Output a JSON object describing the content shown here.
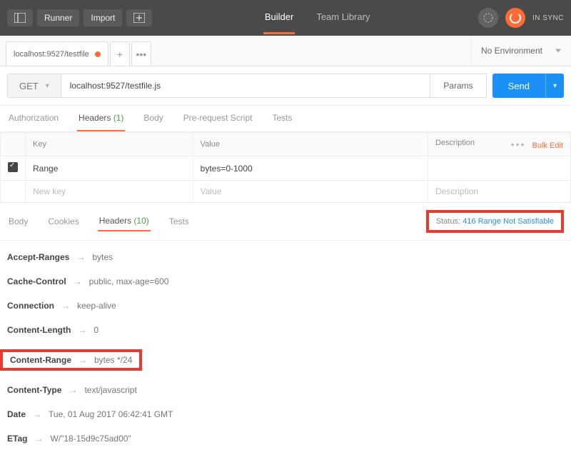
{
  "topbar": {
    "runner": "Runner",
    "import": "Import",
    "builder": "Builder",
    "team_library": "Team Library",
    "sync": "IN SYNC"
  },
  "tab": {
    "title": "localhost:9527/testfile",
    "add": "+",
    "more": "•••"
  },
  "env": {
    "label": "No Environment"
  },
  "request": {
    "method": "GET",
    "url": "localhost:9527/testfile.js",
    "params": "Params",
    "send": "Send"
  },
  "req_tabs": {
    "auth": "Authorization",
    "headers": "Headers",
    "headers_count": "(1)",
    "body": "Body",
    "prereq": "Pre-request Script",
    "tests": "Tests"
  },
  "headers_table": {
    "th_key": "Key",
    "th_value": "Value",
    "th_desc": "Description",
    "bulk": "Bulk Edit",
    "more": "•••",
    "row1_key": "Range",
    "row1_val": "bytes=0-1000",
    "ph_key": "New key",
    "ph_val": "Value",
    "ph_desc": "Description"
  },
  "res_tabs": {
    "body": "Body",
    "cookies": "Cookies",
    "headers": "Headers",
    "headers_count": "(10)",
    "tests": "Tests",
    "status_label": "Status:",
    "status_val": "416 Range Not Satisfiable"
  },
  "resp_headers": [
    {
      "key": "Accept-Ranges",
      "val": "bytes"
    },
    {
      "key": "Cache-Control",
      "val": "public, max-age=600"
    },
    {
      "key": "Connection",
      "val": "keep-alive"
    },
    {
      "key": "Content-Length",
      "val": "0"
    },
    {
      "key": "Content-Range",
      "val": "bytes */24",
      "highlight": true
    },
    {
      "key": "Content-Type",
      "val": "text/javascript"
    },
    {
      "key": "Date",
      "val": "Tue, 01 Aug 2017 06:42:41 GMT"
    },
    {
      "key": "ETag",
      "val": "W/\"18-15d9c75ad00\""
    }
  ]
}
